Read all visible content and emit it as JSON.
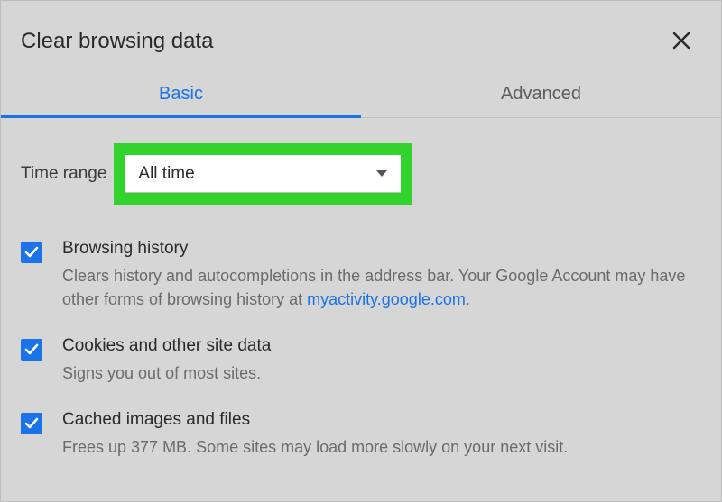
{
  "header": {
    "title": "Clear browsing data"
  },
  "tabs": {
    "basic": "Basic",
    "advanced": "Advanced"
  },
  "time_range": {
    "label": "Time range",
    "value": "All time"
  },
  "options": {
    "browsing": {
      "title": "Browsing history",
      "desc_pre": "Clears history and autocompletions in the address bar. Your Google Account may have other forms of browsing history at ",
      "link_text": "myactivity.google.com",
      "desc_post": "."
    },
    "cookies": {
      "title": "Cookies and other site data",
      "desc": "Signs you out of most sites."
    },
    "cached": {
      "title": "Cached images and files",
      "desc": "Frees up 377 MB. Some sites may load more slowly on your next visit."
    }
  }
}
